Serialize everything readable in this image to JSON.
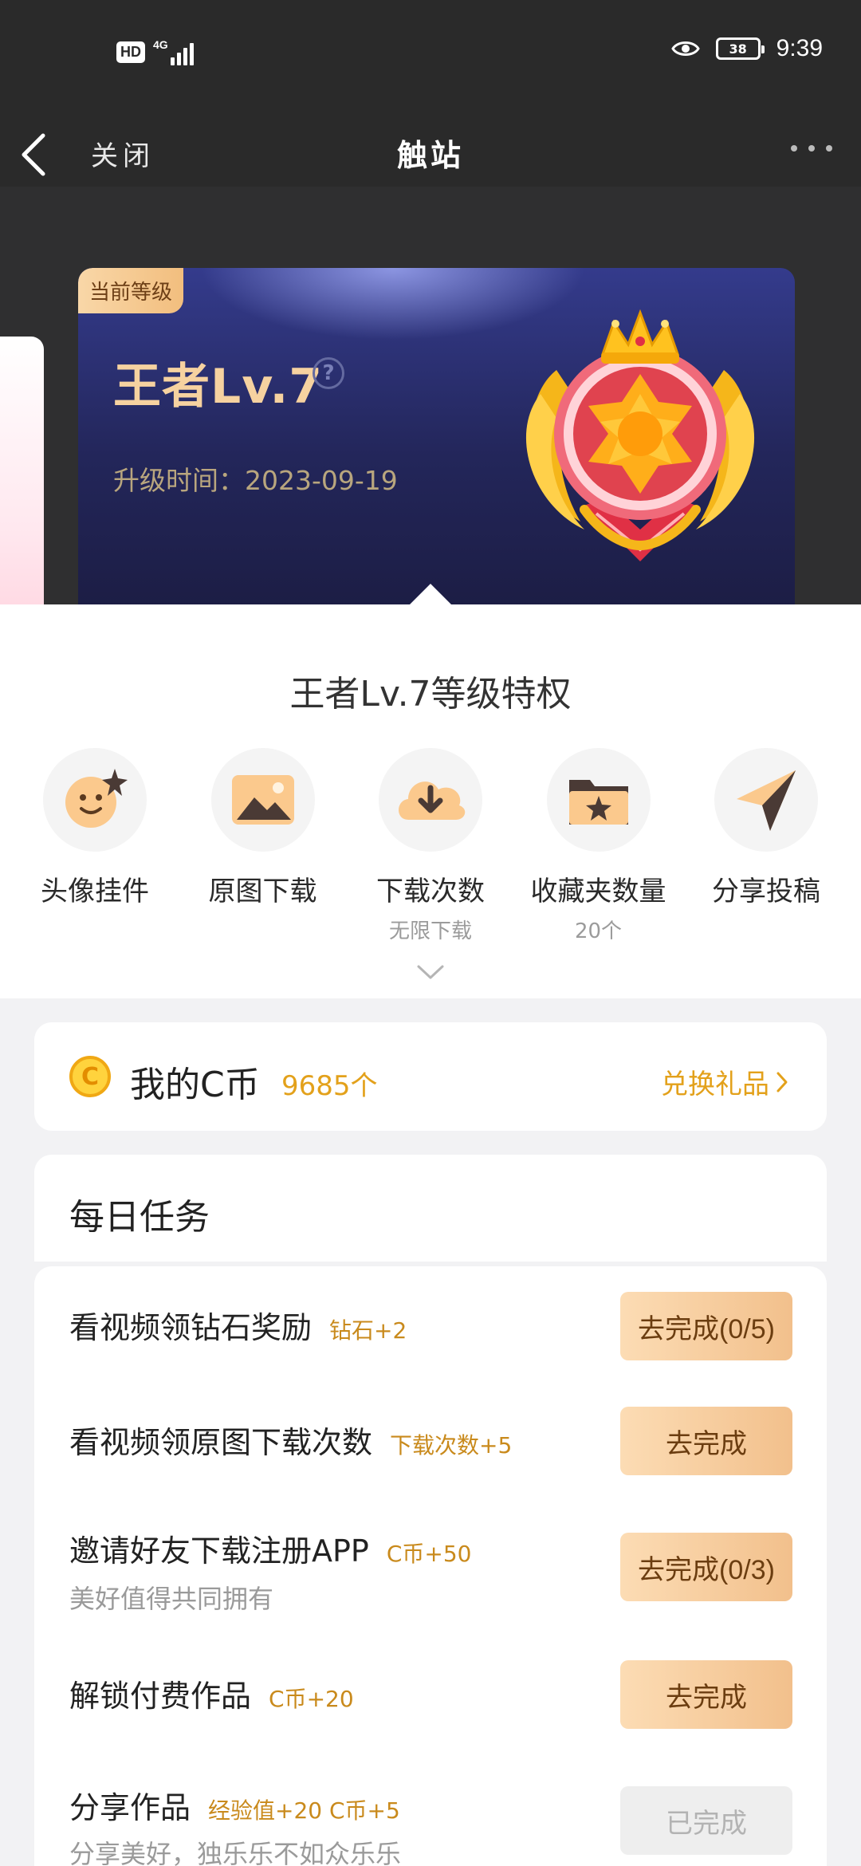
{
  "status_bar": {
    "hd": "HD",
    "network": "4G",
    "battery": "38",
    "time": "9:39"
  },
  "app_bar": {
    "close_label": "关闭",
    "title": "触站"
  },
  "level": {
    "tag": "当前等级",
    "name": "王者Lv.7",
    "help": "?",
    "upgrade_time": "升级时间：2023-09-19"
  },
  "privileges": {
    "title": "王者Lv.7等级特权",
    "items": [
      {
        "label": "头像挂件",
        "sub": "",
        "icon": "avatar-pendant-icon"
      },
      {
        "label": "原图下载",
        "sub": "",
        "icon": "original-image-icon"
      },
      {
        "label": "下载次数",
        "sub": "无限下载",
        "icon": "download-cloud-icon"
      },
      {
        "label": "收藏夹数量",
        "sub": "20个",
        "icon": "favorites-folder-icon"
      },
      {
        "label": "分享投稿",
        "sub": "",
        "icon": "share-plane-icon"
      }
    ]
  },
  "coins": {
    "icon_text": "C",
    "label": "我的C币",
    "count": "9685个",
    "exchange": "兑换礼品"
  },
  "tasks": {
    "title": "每日任务",
    "items": [
      {
        "title": "看视频领钻石奖励",
        "reward": "钻石+2",
        "desc": "",
        "button": "去完成(0/5)",
        "done": false
      },
      {
        "title": "看视频领原图下载次数",
        "reward": "下载次数+5",
        "desc": "",
        "button": "去完成",
        "done": false
      },
      {
        "title": "邀请好友下载注册APP",
        "reward": "C币+50",
        "desc": "美好值得共同拥有",
        "button": "去完成(0/3)",
        "done": false
      },
      {
        "title": "解锁付费作品",
        "reward": "C币+20",
        "desc": "",
        "button": "去完成",
        "done": false
      },
      {
        "title": "分享作品",
        "reward": "经验值+20 C币+5",
        "desc": "分享美好，独乐乐不如众乐乐",
        "button": "已完成",
        "done": true
      }
    ]
  },
  "colors": {
    "accent_gold": "#e3a11b",
    "button_gradient_start": "#fcdcb4",
    "button_gradient_end": "#f2c08c",
    "dark_header": "#2a2a2a",
    "level_card": "#23265a"
  }
}
